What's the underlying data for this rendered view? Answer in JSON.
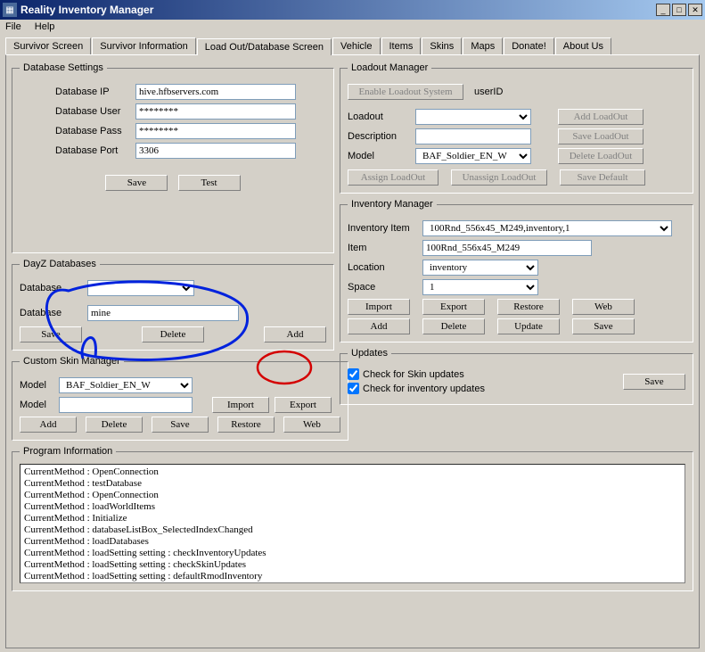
{
  "window": {
    "title": "Reality Inventory Manager"
  },
  "menubar": {
    "file": "File",
    "help": "Help"
  },
  "tabs": [
    {
      "label": "Survivor Screen"
    },
    {
      "label": "Survivor Information"
    },
    {
      "label": "Load Out/Database Screen"
    },
    {
      "label": "Vehicle"
    },
    {
      "label": "Items"
    },
    {
      "label": "Skins"
    },
    {
      "label": "Maps"
    },
    {
      "label": "Donate!"
    },
    {
      "label": "About Us"
    }
  ],
  "db": {
    "legend": "Database Settings",
    "ip_label": "Database IP",
    "ip": "hive.hfbservers.com",
    "user_label": "Database User",
    "user": "********",
    "pass_label": "Database Pass",
    "pass": "********",
    "port_label": "Database Port",
    "port": "3306",
    "save": "Save",
    "test": "Test"
  },
  "dayz": {
    "legend": "DayZ Databases",
    "database_sel_label": "Database",
    "database_sel": "",
    "database_txt_label": "Database",
    "database_txt": "mine",
    "save": "Save",
    "delete": "Delete",
    "add": "Add"
  },
  "skin": {
    "legend": "Custom Skin Manager",
    "model_sel_label": "Model",
    "model_sel": "BAF_Soldier_EN_W",
    "model_txt_label": "Model",
    "model_txt": "",
    "import": "Import",
    "export": "Export",
    "add": "Add",
    "delete": "Delete",
    "save": "Save",
    "restore": "Restore",
    "web": "Web"
  },
  "loadout": {
    "legend": "Loadout Manager",
    "enable_btn": "Enable Loadout System",
    "userid": "userID",
    "loadout_label": "Loadout",
    "loadout": "",
    "desc_label": "Description",
    "desc": "",
    "model_label": "Model",
    "model": "BAF_Soldier_EN_W",
    "add": "Add LoadOut",
    "save": "Save LoadOut",
    "del": "Delete LoadOut",
    "assign": "Assign LoadOut",
    "unassign": "Unassign LoadOut",
    "save_default": "Save Default"
  },
  "inv": {
    "legend": "Inventory Manager",
    "item_label": "Inventory Item",
    "item_sel": "100Rnd_556x45_M249,inventory,1",
    "item2_label": "Item",
    "item2_val": "100Rnd_556x45_M249",
    "loc_label": "Location",
    "loc": "inventory",
    "space_label": "Space",
    "space": "1",
    "import": "Import",
    "export": "Export",
    "restore": "Restore",
    "web": "Web",
    "add": "Add",
    "delete": "Delete",
    "update": "Update",
    "save": "Save"
  },
  "updates": {
    "legend": "Updates",
    "skin_chk": "Check for Skin updates",
    "inv_chk": "Check for inventory updates",
    "save": "Save"
  },
  "log": {
    "legend": "Program Information",
    "lines": "CurrentMethod : OpenConnection\nCurrentMethod : testDatabase\nCurrentMethod : OpenConnection\nCurrentMethod : loadWorldItems\nCurrentMethod : Initialize\nCurrentMethod : databaseListBox_SelectedIndexChanged\nCurrentMethod : loadDatabases\nCurrentMethod : loadSetting setting : checkInventoryUpdates\nCurrentMethod : loadSetting setting : checkSkinUpdates\nCurrentMethod : loadSetting setting : defaultRmodInventory\nCurrentMethod : loadSetting setting : databasePass"
  }
}
